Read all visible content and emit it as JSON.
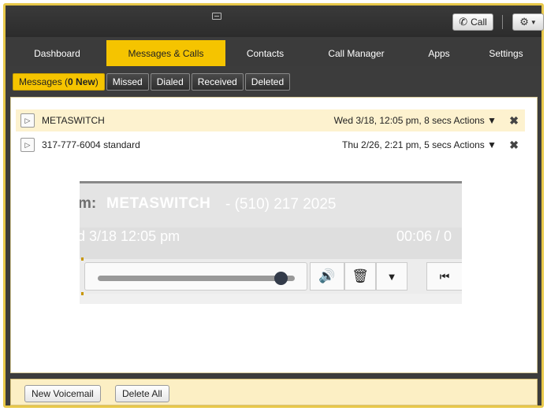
{
  "toolbar": {
    "call_label": "Call"
  },
  "nav": {
    "items": [
      {
        "label": "Dashboard",
        "active": false
      },
      {
        "label": "Messages & Calls",
        "active": true
      },
      {
        "label": "Contacts",
        "active": false
      },
      {
        "label": "Call Manager",
        "active": false
      },
      {
        "label": "Apps",
        "active": false
      },
      {
        "label": "Settings",
        "active": false
      }
    ]
  },
  "subtabs": {
    "messages_prefix": "Messages (",
    "messages_count": "0 New",
    "messages_suffix": ")",
    "missed": "Missed",
    "dialed": "Dialed",
    "received": "Received",
    "deleted": "Deleted"
  },
  "messages": [
    {
      "name": "METASWITCH",
      "meta": "Wed 3/18, 12:05 pm, 8 secs",
      "actions": "Actions ▼",
      "selected": true
    },
    {
      "name": "317-777-6004 standard",
      "meta": "Thu 2/26, 2:21 pm, 5 secs",
      "actions": "Actions ▼",
      "selected": false
    }
  ],
  "player": {
    "from_label": "m:",
    "from_name": "METASWITCH",
    "from_number": "- (510) 217 2025",
    "date": "d 3/18 12:05 pm",
    "time": "00:06 / 0",
    "progress": 0.93
  },
  "footer": {
    "new_voicemail": "New Voicemail",
    "delete_all": "Delete All"
  },
  "colors": {
    "accent": "#f5c400",
    "chrome": "#3c3c3c",
    "selected_row": "#fdf2cf"
  }
}
